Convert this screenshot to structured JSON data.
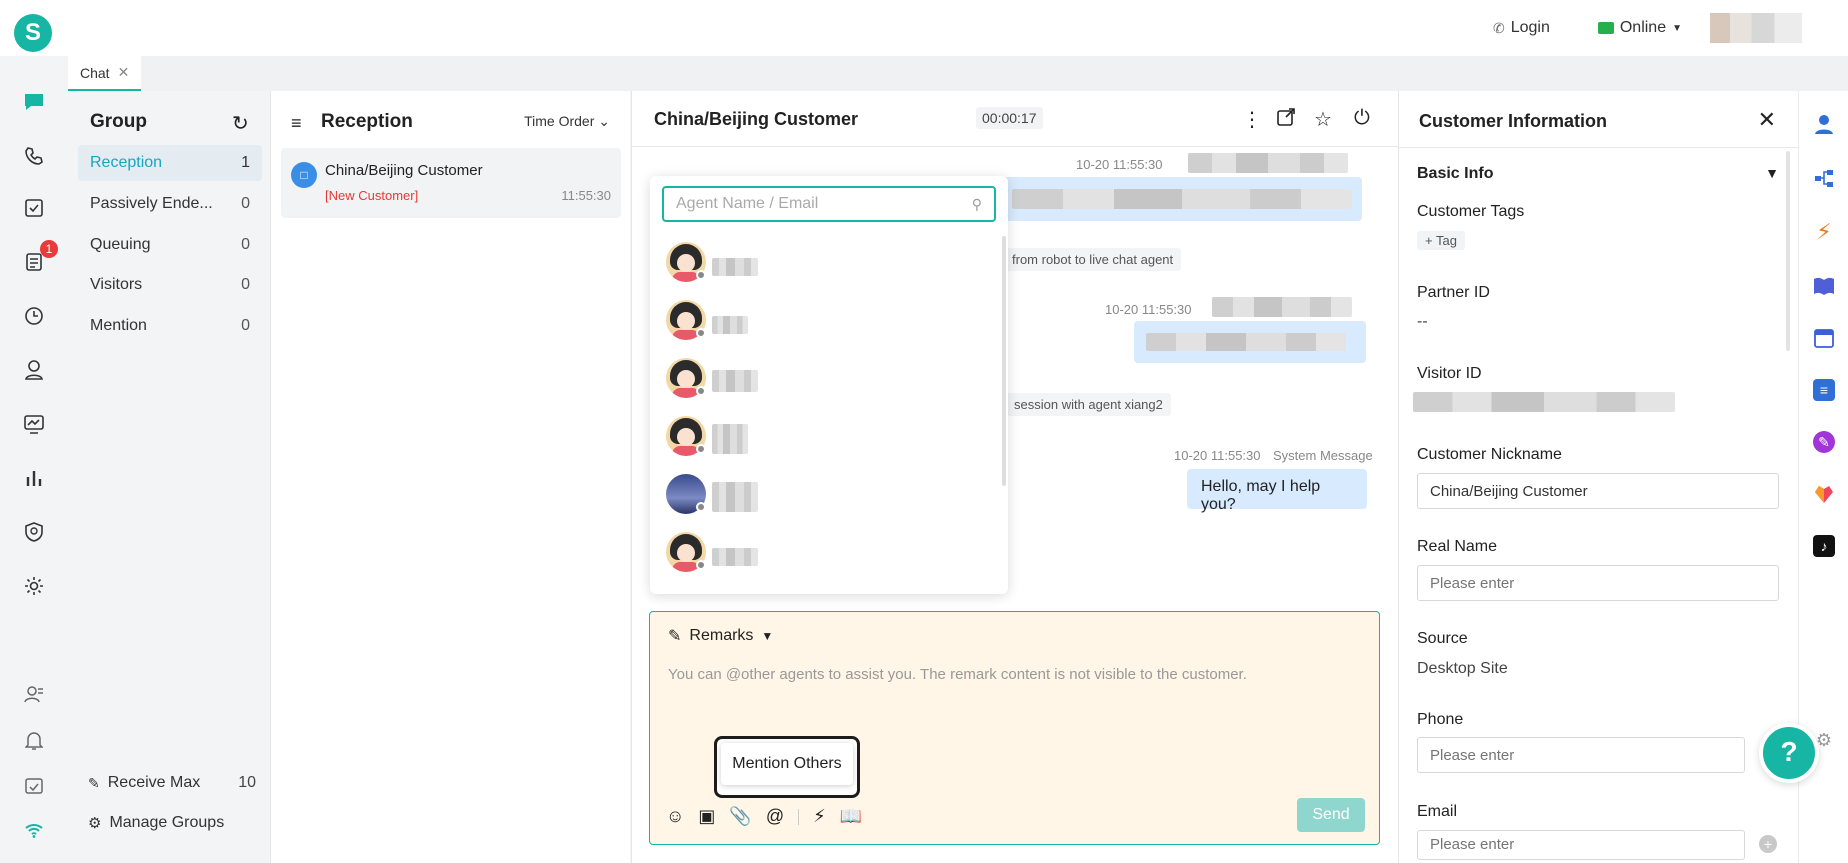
{
  "topbar": {
    "logo_letter": "S",
    "login_label": "Login",
    "status_label": "Online"
  },
  "tabs": [
    {
      "label": "Chat"
    }
  ],
  "rail": {
    "icons": [
      "chat-icon",
      "phone-icon",
      "task-icon",
      "ticket-icon",
      "history-icon",
      "contacts-icon",
      "monitor-icon",
      "stats-icon",
      "shield-icon",
      "settings-icon",
      "agent-icon",
      "bell-icon",
      "inbox-icon",
      "wifi-icon"
    ],
    "ticket_badge": "1"
  },
  "group": {
    "title": "Group",
    "items": [
      {
        "label": "Reception",
        "count": "1"
      },
      {
        "label": "Passively Ende...",
        "count": "0"
      },
      {
        "label": "Queuing",
        "count": "0"
      },
      {
        "label": "Visitors",
        "count": "0"
      },
      {
        "label": "Mention",
        "count": "0"
      }
    ],
    "receive_max_label": "Receive Max",
    "receive_max_value": "10",
    "manage_groups_label": "Manage Groups"
  },
  "reception": {
    "title": "Reception",
    "order_label": "Time Order",
    "conversation": {
      "name": "China/Beijing Customer",
      "tag": "[New Customer]",
      "time": "11:55:30"
    }
  },
  "chat": {
    "title": "China/Beijing Customer",
    "timer": "00:00:17",
    "messages": [
      {
        "time": "10-20 11:55:30"
      },
      {
        "note": "from robot to live chat agent"
      },
      {
        "time": "10-20 11:55:30"
      },
      {
        "note": "session with agent xiang2"
      },
      {
        "time": "10-20 11:55:30",
        "sender": "System Message",
        "text": "Hello, may I help you?"
      }
    ]
  },
  "mention_popup": {
    "search_placeholder": "Agent Name / Email"
  },
  "composer": {
    "mode_label": "Remarks",
    "placeholder": "You can @other agents to assist you. The remark content is not visible to the customer.",
    "tooltip": "Mention Others",
    "send_label": "Send"
  },
  "customer_info": {
    "title": "Customer Information",
    "section": "Basic Info",
    "tags_label": "Customer Tags",
    "tag_button": "+ Tag",
    "partner_id_label": "Partner ID",
    "partner_id_value": "--",
    "visitor_id_label": "Visitor ID",
    "nickname_label": "Customer Nickname",
    "nickname_value": "China/Beijing Customer",
    "real_name_label": "Real Name",
    "real_name_placeholder": "Please enter",
    "source_label": "Source",
    "source_value": "Desktop Site",
    "phone_label": "Phone",
    "phone_placeholder": "Please enter",
    "email_label": "Email",
    "email_placeholder": "Please enter"
  },
  "colors": {
    "accent": "#17b5a3",
    "bubble": "#d7eafe",
    "composer_bg": "#fff6e8",
    "alert": "#e53935"
  }
}
